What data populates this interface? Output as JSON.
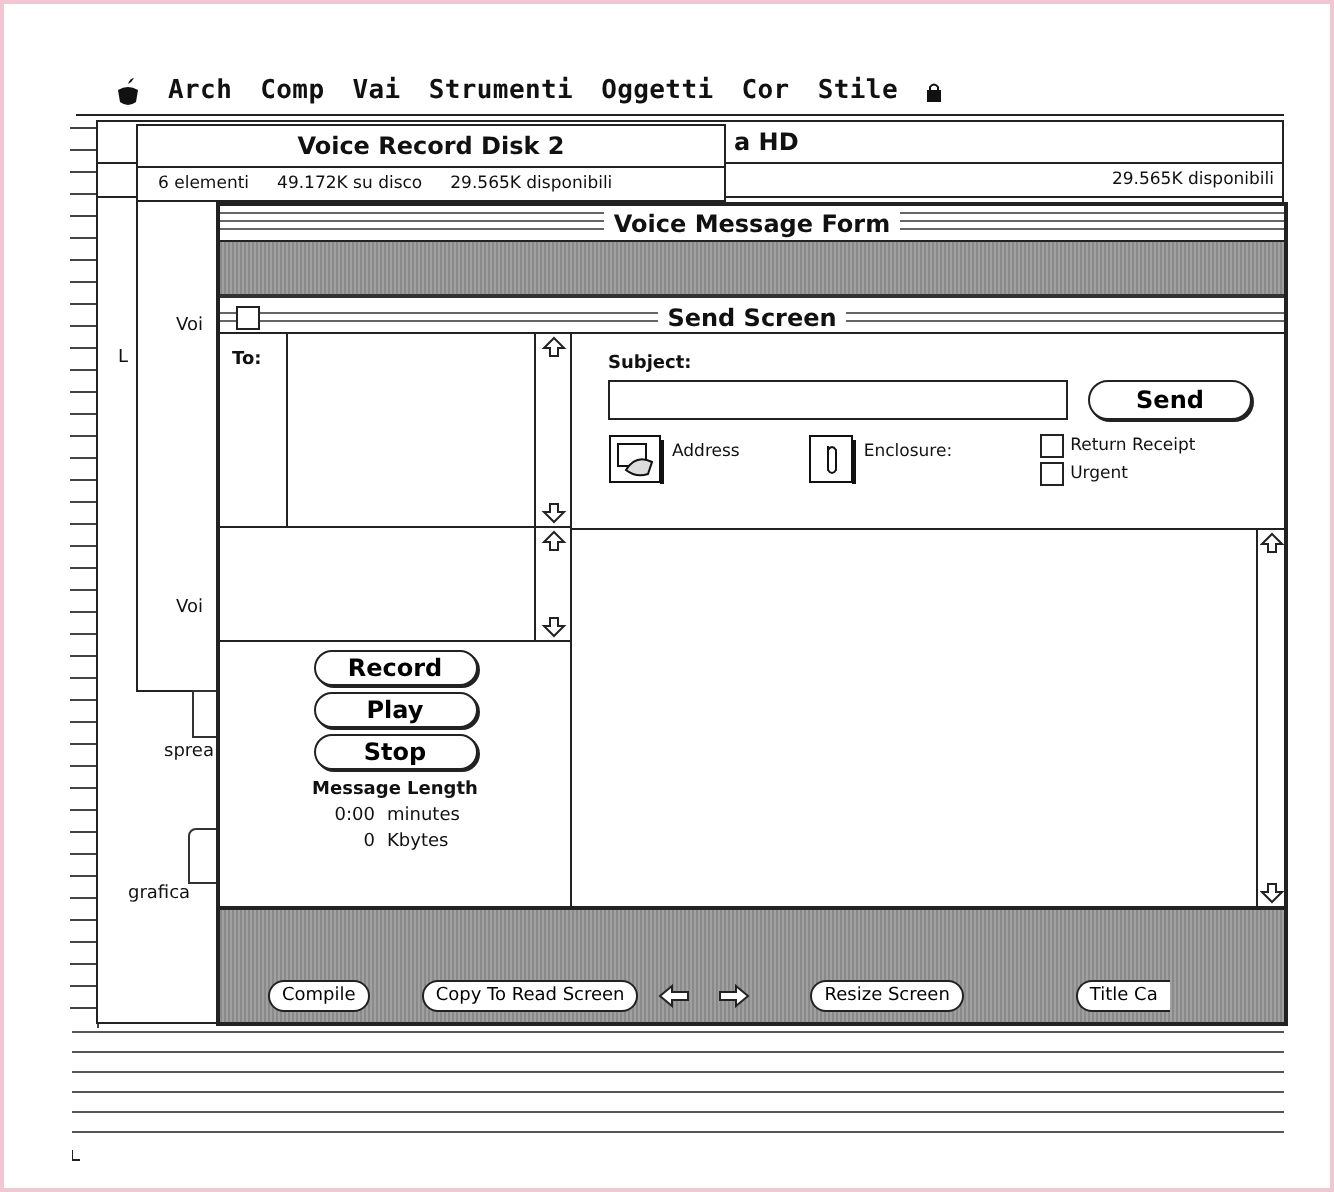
{
  "menu_bar": {
    "items": [
      "Arch",
      "Comp",
      "Vai",
      "Strumenti",
      "Oggetti",
      "Cor",
      "Stile"
    ]
  },
  "disk_window": {
    "title": "a HD",
    "free": "29.565K disponibili"
  },
  "folder_window": {
    "title": "Voice Record Disk 2",
    "items_count": "6 elementi",
    "used": "49.172K su disco",
    "free": "29.565K disponibili"
  },
  "background_labels": [
    "L",
    "Voi",
    "Voi",
    "sprea",
    "grafica"
  ],
  "form_window": {
    "title": "Voice Message Form",
    "toolbar_buttons": [
      "Compile",
      "Copy To Read Screen",
      "Resize Screen",
      "Title Ca"
    ]
  },
  "send_screen": {
    "title": "Send Screen",
    "to_label": "To:",
    "subject_label": "Subject:",
    "send_button": "Send",
    "address_label": "Address",
    "enclosure_label": "Enclosure:",
    "options": [
      {
        "label": "Return Receipt",
        "checked": false
      },
      {
        "label": "Urgent",
        "checked": false
      }
    ],
    "buttons": [
      "Record",
      "Play",
      "Stop"
    ],
    "length_title": "Message Length",
    "length_rows": [
      {
        "value": "0:00",
        "unit": "minutes"
      },
      {
        "value": "0",
        "unit": "Kbytes"
      }
    ]
  }
}
